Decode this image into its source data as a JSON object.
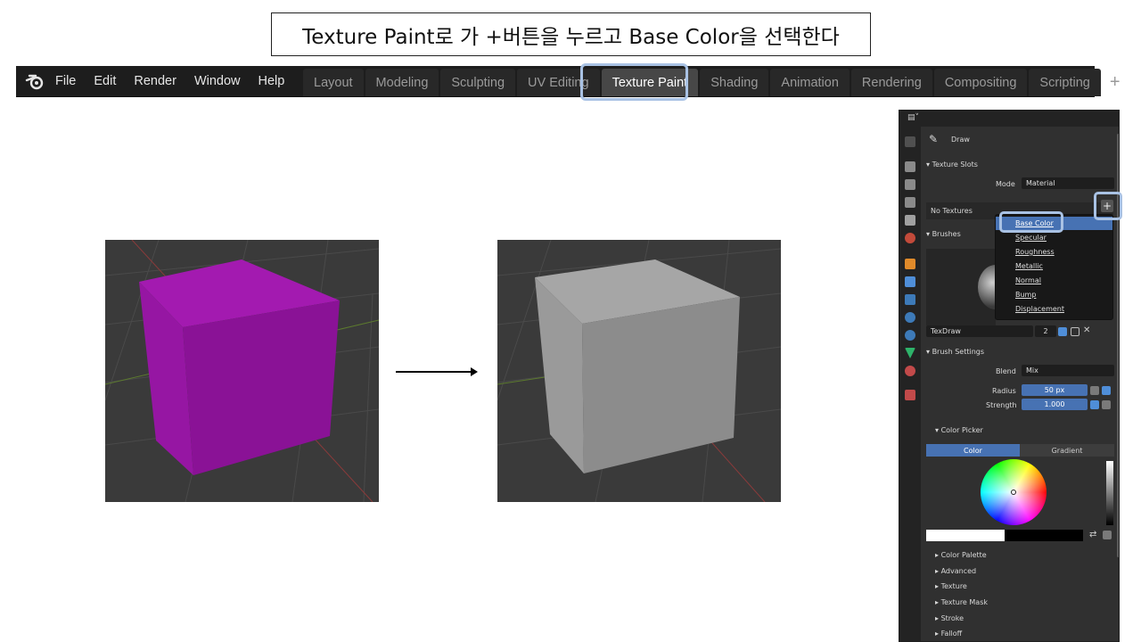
{
  "caption": "Texture Paint로 가 +버튼을 누르고 Base Color을 선택한다",
  "topbar": {
    "menu": [
      "File",
      "Edit",
      "Render",
      "Window",
      "Help"
    ],
    "tabs": [
      "Layout",
      "Modeling",
      "Sculpting",
      "UV Editing",
      "Texture Paint",
      "Shading",
      "Animation",
      "Rendering",
      "Compositing",
      "Scripting"
    ],
    "active_tab": "Texture Paint",
    "add_tab": "+"
  },
  "viewports": {
    "before_cube_color": "#9e16a8",
    "after_cube_color": "#8c8c8c"
  },
  "panel": {
    "tool_name": "Draw",
    "texture_slots": {
      "header": "Texture Slots",
      "mode_label": "Mode",
      "mode_value": "Material",
      "list_empty": "No Textures",
      "add_button": "+"
    },
    "dropdown": [
      "Base Color",
      "Specular",
      "Roughness",
      "Metallic",
      "Normal",
      "Bump",
      "Displacement"
    ],
    "selected_option": "Base Color",
    "brushes": {
      "header": "Brushes",
      "brush_name": "TexDraw",
      "user_count": "2"
    },
    "brush_settings": {
      "header": "Brush Settings",
      "blend_label": "Blend",
      "blend_value": "Mix",
      "radius_label": "Radius",
      "radius_value": "50 px",
      "strength_label": "Strength",
      "strength_value": "1.000"
    },
    "color_picker": {
      "header": "Color Picker",
      "tab_color": "Color",
      "tab_gradient": "Gradient"
    },
    "collapsed": [
      "Color Palette",
      "Advanced",
      "Texture",
      "Texture Mask",
      "Stroke",
      "Falloff"
    ]
  },
  "colors": {
    "accent": "#4772b3",
    "highlight": "#a9c2e4"
  }
}
